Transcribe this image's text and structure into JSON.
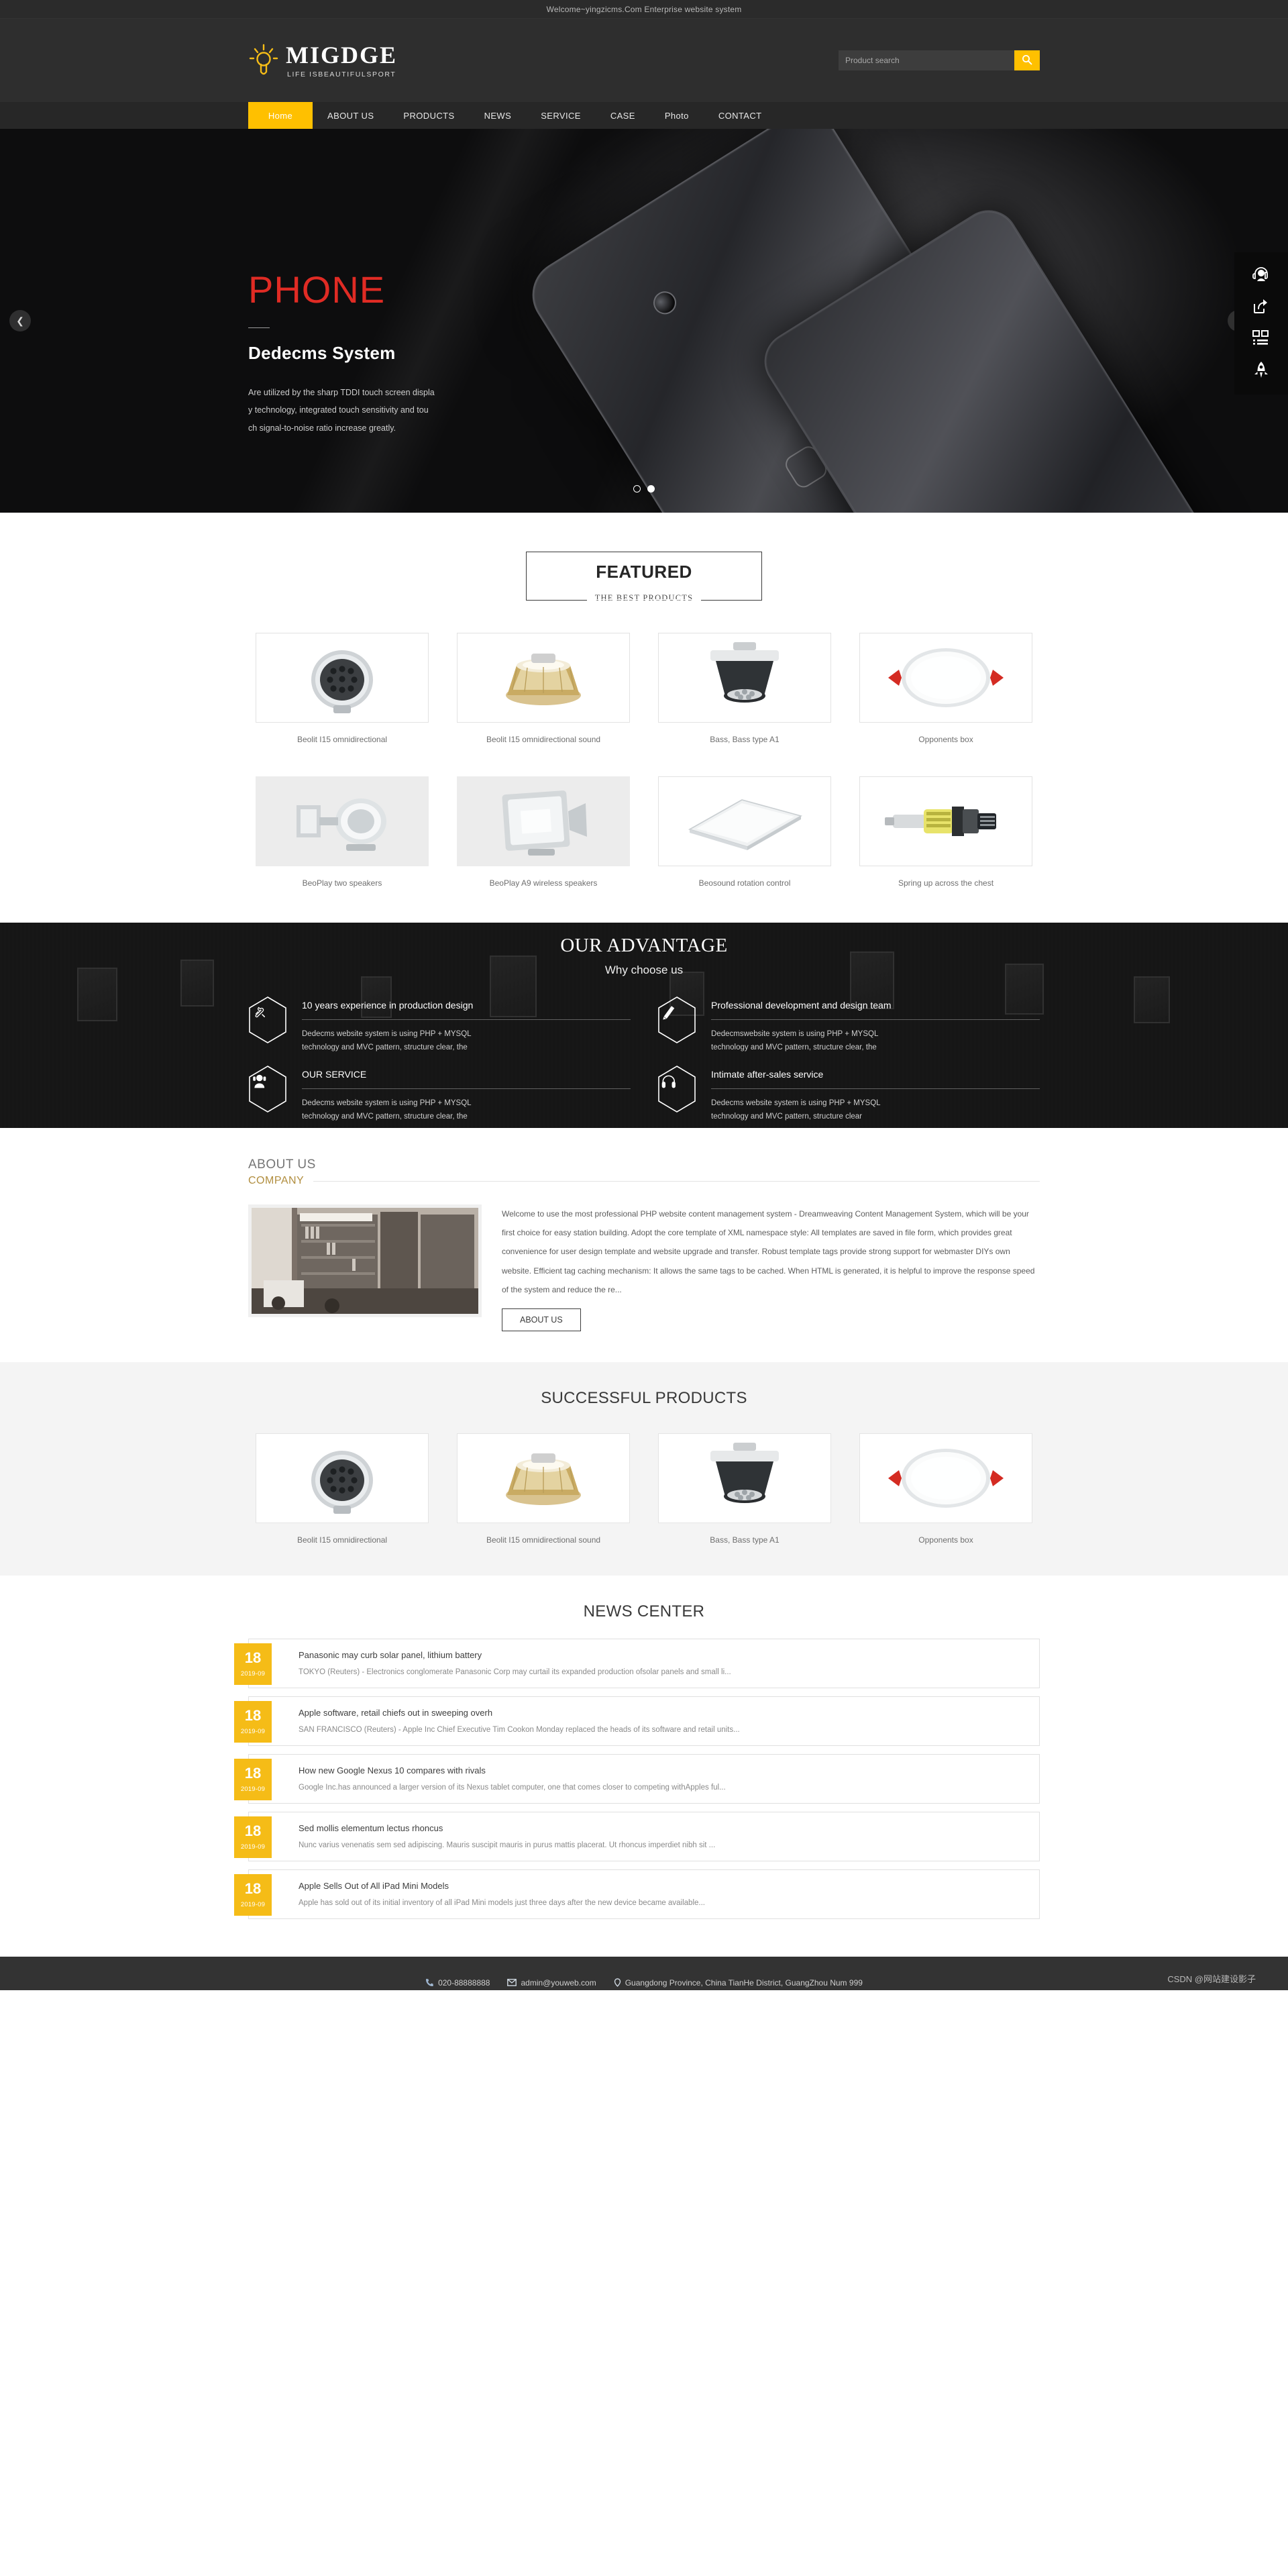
{
  "topbar": {
    "welcome": "Welcome~yingzicms.Com Enterprise website system"
  },
  "header": {
    "logo_title": "MIGDGE",
    "logo_sub": "LIFE ISBEAUTIFULSPORT",
    "logo_icon": "lightbulb-icon",
    "search_placeholder": "Product search",
    "search_value": "",
    "search_icon": "search-icon",
    "accent_color": "#ffc000"
  },
  "nav": {
    "items": [
      {
        "label": "Home",
        "active": true
      },
      {
        "label": "ABOUT US",
        "active": false
      },
      {
        "label": "PRODUCTS",
        "active": false
      },
      {
        "label": "NEWS",
        "active": false
      },
      {
        "label": "SERVICE",
        "active": false
      },
      {
        "label": "CASE",
        "active": false
      },
      {
        "label": "Photo",
        "active": false
      },
      {
        "label": "CONTACT",
        "active": false
      }
    ]
  },
  "hero": {
    "title": "PHONE",
    "subtitle": "Dedecms System",
    "description": "Are utilized by the sharp TDDI touch screen display technology, integrated touch sensitivity and touch signal-to-noise ratio increase greatly.",
    "desc_line1": "Are utilized by the sharp TDDI touch screen displa",
    "desc_line2": "y technology, integrated touch sensitivity and tou",
    "desc_line3": "ch signal-to-noise ratio increase greatly.",
    "prev_icon": "chevron-left-icon",
    "next_icon": "chevron-right-icon",
    "title_color": "#e02b24",
    "slides": 2,
    "active_slide": 2
  },
  "rail": {
    "items": [
      {
        "icon": "headset-support-icon"
      },
      {
        "icon": "share-icon"
      },
      {
        "icon": "qr-list-icon"
      },
      {
        "icon": "rocket-top-icon"
      }
    ]
  },
  "featured": {
    "title": "FEATURED",
    "subtitle": "THE BEST PRODUCTS",
    "products_row1": [
      {
        "name": "Beolit I15 omnidirectional",
        "art": "led-floodlight"
      },
      {
        "name": "Beolit I15 omnidirectional sound",
        "art": "gold-downlight"
      },
      {
        "name": "Bass, Bass type A1",
        "art": "spot-downlight"
      },
      {
        "name": "Opponents box",
        "art": "round-panel"
      }
    ],
    "products_row2": [
      {
        "name": "BeoPlay two speakers",
        "art": "bracket-light"
      },
      {
        "name": "BeoPlay A9 wireless speakers",
        "art": "square-floodlight"
      },
      {
        "name": "Beosound rotation control",
        "art": "flat-panel"
      },
      {
        "name": "Spring up across the chest",
        "art": "led-bulb"
      }
    ]
  },
  "advantage": {
    "title": "OUR ADVANTAGE",
    "subtitle": "Why choose us",
    "items": [
      {
        "icon": "tools-icon",
        "title": "10 years experience in production design",
        "desc_line1": "Dedecms website system is using PHP + MYSQL",
        "desc_line2": "technology and MVC pattern, structure clear, the"
      },
      {
        "icon": "pencil-icon",
        "title": "Professional development and design team",
        "desc_line1": "Dedecmswebsite system is using PHP + MYSQL",
        "desc_line2": "technology and MVC pattern, structure clear, the"
      },
      {
        "icon": "agent-icon",
        "title": "OUR SERVICE",
        "desc_line1": "Dedecms website system is using PHP + MYSQL",
        "desc_line2": "technology and MVC pattern, structure clear, the"
      },
      {
        "icon": "headphones-icon",
        "title": "Intimate after-sales service",
        "desc_line1": "Dedecms website system is using PHP + MYSQL",
        "desc_line2": "technology and MVC pattern, structure clear"
      }
    ]
  },
  "about": {
    "heading": "ABOUT US",
    "company": "COMPANY",
    "image_alt": "office-interior-photo",
    "text": "Welcome to use the most professional PHP website content management system - Dreamweaving Content Management System, which will be your first choice for easy station building. Adopt the core template of XML namespace style: All templates are saved in file form, which provides great convenience for user design template and website upgrade and transfer. Robust template tags provide strong support for webmaster DIYs own website. Efficient tag caching mechanism: It allows the same tags to be cached. When HTML is generated, it is helpful to improve the response speed of the system and reduce the re...",
    "button_label": "ABOUT US"
  },
  "success": {
    "title": "SUCCESSFUL PRODUCTS",
    "products": [
      {
        "name": "Beolit I15 omnidirectional",
        "art": "led-floodlight"
      },
      {
        "name": "Beolit I15 omnidirectional sound",
        "art": "gold-downlight"
      },
      {
        "name": "Bass, Bass type A1",
        "art": "spot-downlight"
      },
      {
        "name": "Opponents box",
        "art": "round-panel"
      }
    ]
  },
  "news": {
    "title": "NEWS CENTER",
    "items": [
      {
        "day": "18",
        "month": "2019-09",
        "title": "Panasonic may curb solar panel, lithium battery",
        "summary": "TOKYO (Reuters) - Electronics conglomerate Panasonic Corp may curtail its expanded production ofsolar panels and small li..."
      },
      {
        "day": "18",
        "month": "2019-09",
        "title": "Apple software, retail chiefs out in sweeping overh",
        "summary": "SAN FRANCISCO (Reuters) - Apple Inc Chief Executive Tim Cookon Monday replaced the heads of its software and retail units..."
      },
      {
        "day": "18",
        "month": "2019-09",
        "title": "How new Google Nexus 10 compares with rivals",
        "summary": "Google Inc.has announced a larger version of its Nexus tablet computer, one that comes closer to competing withApples ful..."
      },
      {
        "day": "18",
        "month": "2019-09",
        "title": "Sed mollis elementum lectus rhoncus",
        "summary": "Nunc varius venenatis sem sed adipiscing. Mauris suscipit mauris in purus mattis placerat. Ut rhoncus imperdiet nibh sit ..."
      },
      {
        "day": "18",
        "month": "2019-09",
        "title": "Apple Sells Out of All iPad Mini Models",
        "summary": "Apple has sold out of its initial inventory of all iPad Mini models just three days after the new device became available..."
      }
    ]
  },
  "footer": {
    "phone": "020-88888888",
    "email": "admin@youweb.com",
    "address": "Guangdong Province, China TianHe District, GuangZhou Num 999",
    "phone_icon": "phone-icon",
    "email_icon": "mail-icon",
    "address_icon": "location-icon",
    "watermark": "CSDN @网站建设影子"
  }
}
